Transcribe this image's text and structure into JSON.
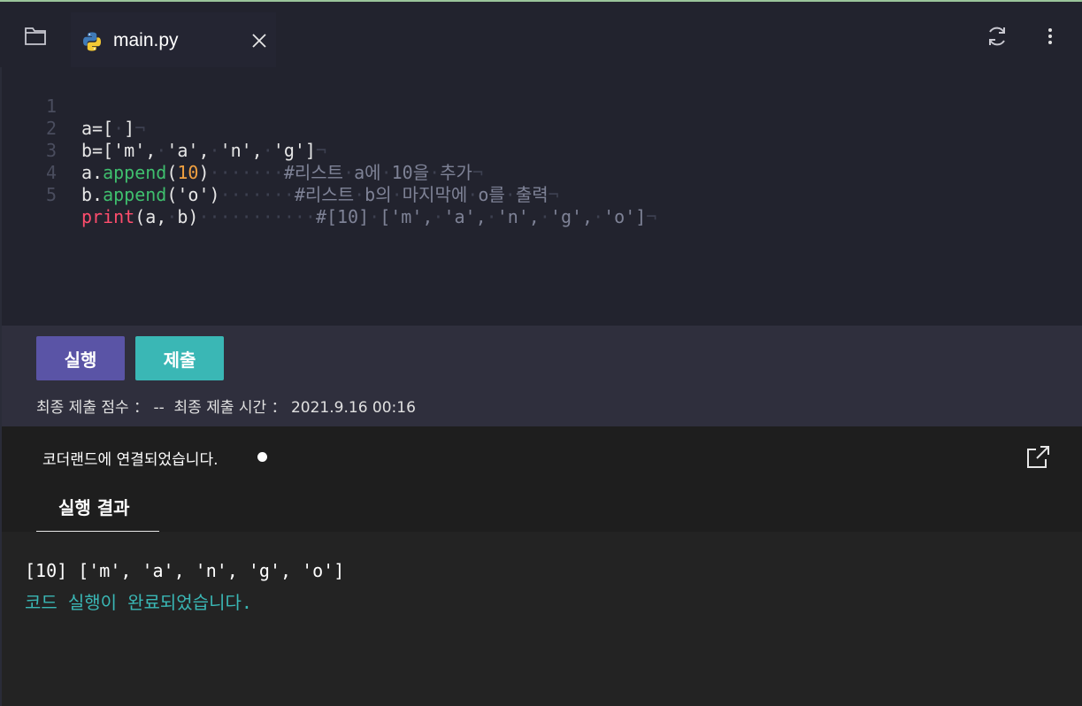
{
  "tab": {
    "filename": "main.py",
    "icon": "python-icon"
  },
  "editor": {
    "line_numbers": [
      "1",
      "2",
      "3",
      "4",
      "5"
    ],
    "lines": [
      {
        "segments": [
          {
            "t": "a=[",
            "c": ""
          },
          {
            "t": "·",
            "c": "ws"
          },
          {
            "t": "]",
            "c": ""
          },
          {
            "t": "¬",
            "c": "eol"
          }
        ]
      },
      {
        "segments": [
          {
            "t": "b=['m',",
            "c": ""
          },
          {
            "t": "·",
            "c": "ws"
          },
          {
            "t": "'a',",
            "c": ""
          },
          {
            "t": "·",
            "c": "ws"
          },
          {
            "t": "'n',",
            "c": ""
          },
          {
            "t": "·",
            "c": "ws"
          },
          {
            "t": "'g']",
            "c": ""
          },
          {
            "t": "¬",
            "c": "eol"
          }
        ]
      },
      {
        "segments": [
          {
            "t": "a.",
            "c": ""
          },
          {
            "t": "append",
            "c": "fn"
          },
          {
            "t": "(",
            "c": ""
          },
          {
            "t": "10",
            "c": "num"
          },
          {
            "t": ")",
            "c": ""
          },
          {
            "t": "·······",
            "c": "ws"
          },
          {
            "t": "#리스트",
            "c": "cm"
          },
          {
            "t": "·",
            "c": "ws"
          },
          {
            "t": "a에",
            "c": "cm"
          },
          {
            "t": "·",
            "c": "ws"
          },
          {
            "t": "10을",
            "c": "cm"
          },
          {
            "t": "·",
            "c": "ws"
          },
          {
            "t": "추가",
            "c": "cm"
          },
          {
            "t": "¬",
            "c": "eol"
          }
        ]
      },
      {
        "segments": [
          {
            "t": "b.",
            "c": ""
          },
          {
            "t": "append",
            "c": "fn"
          },
          {
            "t": "('o')",
            "c": ""
          },
          {
            "t": "·······",
            "c": "ws"
          },
          {
            "t": "#리스트",
            "c": "cm"
          },
          {
            "t": "·",
            "c": "ws"
          },
          {
            "t": "b의",
            "c": "cm"
          },
          {
            "t": "·",
            "c": "ws"
          },
          {
            "t": "마지막에",
            "c": "cm"
          },
          {
            "t": "·",
            "c": "ws"
          },
          {
            "t": "o를",
            "c": "cm"
          },
          {
            "t": "·",
            "c": "ws"
          },
          {
            "t": "출력",
            "c": "cm"
          },
          {
            "t": "¬",
            "c": "eol"
          }
        ]
      },
      {
        "segments": [
          {
            "t": "print",
            "c": "kw"
          },
          {
            "t": "(a,",
            "c": ""
          },
          {
            "t": "·",
            "c": "ws"
          },
          {
            "t": "b)",
            "c": ""
          },
          {
            "t": "···········",
            "c": "ws"
          },
          {
            "t": "#[10]",
            "c": "cm"
          },
          {
            "t": "·",
            "c": "ws"
          },
          {
            "t": "['m',",
            "c": "cm"
          },
          {
            "t": "·",
            "c": "ws"
          },
          {
            "t": "'a',",
            "c": "cm"
          },
          {
            "t": "·",
            "c": "ws"
          },
          {
            "t": "'n',",
            "c": "cm"
          },
          {
            "t": "·",
            "c": "ws"
          },
          {
            "t": "'g',",
            "c": "cm"
          },
          {
            "t": "·",
            "c": "ws"
          },
          {
            "t": "'o']",
            "c": "cm"
          },
          {
            "t": "¬",
            "c": "eol"
          }
        ]
      }
    ]
  },
  "actions": {
    "run_label": "실행",
    "submit_label": "제출",
    "meta": "최종 제출 점수 ： --  최종 제출 시간 ： 2021.9.16 00:16"
  },
  "output": {
    "connection_status": "코더랜드에 연결되었습니다.",
    "result_tab": "실행 결과",
    "result_line": "[10] ['m', 'a', 'n', 'g', 'o']",
    "done_message": "코드 실행이 완료되었습니다."
  },
  "colors": {
    "run_button": "#5a54a6",
    "submit_button": "#3ab7b5",
    "done_text": "#3ab7b5"
  }
}
